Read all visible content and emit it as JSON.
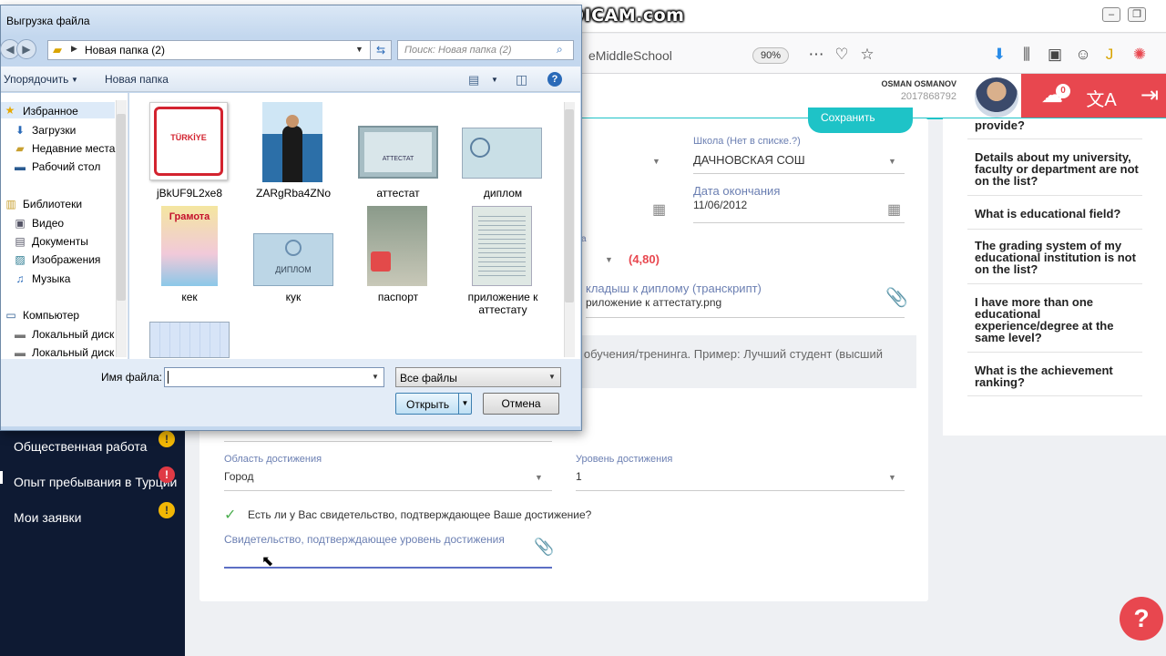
{
  "browser": {
    "url_tail": "eMiddleSchool",
    "zoom": "90%",
    "watermark": "www.BANDICAM.com"
  },
  "header": {
    "user_name": "OSMAN OSMANOV",
    "user_id": "2017868792",
    "notifications": "0"
  },
  "form": {
    "save_label": "Сохранить",
    "school_label": "Школа (Нет в списке.?)",
    "school_value": "ДАЧНОВСКАЯ СОШ",
    "end_date_label": "Дата окончания",
    "end_date_value": "11/06/2012",
    "grade_value": "(4,80)",
    "grade_suffix": "а",
    "transcript_label": "кладыш к диплому (транскрипт)",
    "transcript_file": "риложение к аттестату.png",
    "note_text": "о обучения/тренинга. Пример: Лучший студент (высший",
    "achievement_area_label": "Область достижения",
    "achievement_area_value": "Город",
    "achievement_level_label": "Уровень достижения",
    "achievement_level_value": "1",
    "certificate_question": "Есть ли у Вас свидетельство, подтверждающее Ваше достижение?",
    "certificate_label": "Свидетельство, подтверждающее уровень достижения"
  },
  "sidebar": {
    "items": [
      {
        "label": "Общественная работа",
        "badge": "!",
        "color": "#f2b705"
      },
      {
        "label": "Опыт пребывания в Турции",
        "badge": "!",
        "color": "#e03a45"
      },
      {
        "label": "Мои заявки",
        "badge": "!",
        "color": "#f2b705"
      }
    ]
  },
  "faq": {
    "items": [
      "provide?",
      "Details about my university, faculty or department are not on the list?",
      "What is educational field?",
      "The grading system of my educational institution is not on the list?",
      "I have more than one educational experience/degree at the same level?",
      "What is the achievement ranking?"
    ],
    "help": "?"
  },
  "dialog": {
    "title": "Выгрузка файла",
    "address": "Новая папка (2)",
    "search_placeholder": "Поиск: Новая папка (2)",
    "organize": "Упорядочить",
    "new_folder": "Новая папка",
    "nav": [
      {
        "label": "Избранное",
        "icon": "star-icon"
      },
      {
        "label": "Загрузки",
        "icon": "download-folder-icon"
      },
      {
        "label": "Недавние места",
        "icon": "recent-icon"
      },
      {
        "label": "Рабочий стол",
        "icon": "desktop-icon"
      },
      {
        "label": "Библиотеки",
        "icon": "library-icon"
      },
      {
        "label": "Видео",
        "icon": "video-icon"
      },
      {
        "label": "Документы",
        "icon": "document-icon"
      },
      {
        "label": "Изображения",
        "icon": "image-icon"
      },
      {
        "label": "Музыка",
        "icon": "music-icon"
      },
      {
        "label": "Компьютер",
        "icon": "computer-icon"
      },
      {
        "label": "Локальный диск",
        "icon": "disk-icon"
      },
      {
        "label": "Локальный диск",
        "icon": "disk-icon"
      }
    ],
    "files": [
      {
        "name": "jBkUF9L2xe8",
        "line2": ""
      },
      {
        "name": "ZARgRba4ZNo",
        "line2": ""
      },
      {
        "name": "аттестат",
        "line2": ""
      },
      {
        "name": "диплом",
        "line2": ""
      },
      {
        "name": "кек",
        "line2": ""
      },
      {
        "name": "кук",
        "line2": ""
      },
      {
        "name": "паспорт",
        "line2": ""
      },
      {
        "name": "приложение к",
        "line2": "аттестату"
      }
    ],
    "file_name_label": "Имя файла:",
    "file_name_value": "",
    "file_type": "Все файлы",
    "open_label": "Открыть",
    "cancel_label": "Отмена",
    "thumb_texts": {
      "turkiye": "TÜRKİYE",
      "certificate": "АТТЕСТАТ",
      "gramota": "Грамота",
      "diploma": "ДИПЛОМ"
    }
  },
  "colors": {
    "accent": "#1ec3c7",
    "danger": "#e8474f",
    "sidebar": "#0e1a33",
    "label": "#6b7fb2"
  }
}
